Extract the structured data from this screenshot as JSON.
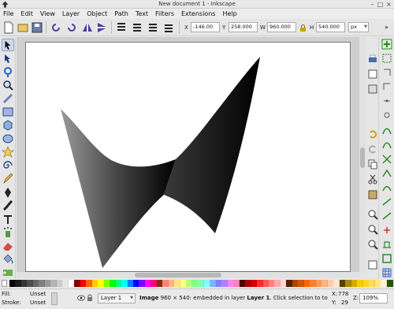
{
  "window": {
    "title": "New document 1 - Inkscape",
    "controls": [
      "minimize-icon",
      "maximize-icon",
      "close-icon"
    ]
  },
  "menu": [
    "File",
    "Edit",
    "View",
    "Layer",
    "Object",
    "Path",
    "Text",
    "Filters",
    "Extensions",
    "Help"
  ],
  "toolbar": {
    "x_label": "X",
    "x_value": "-146.00",
    "y_label": "Y",
    "y_value": "258.000",
    "w_label": "W",
    "w_value": "960.000",
    "h_label": "H",
    "h_value": "540.000",
    "unit": "px"
  },
  "status": {
    "fill_label": "Fill:",
    "stroke_label": "Stroke:",
    "fill_value": "Unset",
    "stroke_value": "Unset",
    "layer": "Layer 1",
    "message_bold1": "Image",
    "message_part1": "960 × 540: embedded in layer",
    "message_bold2": "Layer 1",
    "message_part2": ". Click selection to to",
    "x_label": "X:",
    "x_value": "778",
    "y_label": "Y:",
    "y_value": "29",
    "zoom_label": "Z:",
    "zoom_value": "109%"
  },
  "colors": {
    "shape_dark": "#000000",
    "shape_light": "#9a9a9a",
    "page_border": "#777777",
    "canvas_bg": "#cfcfcf"
  },
  "palette": [
    "#000000",
    "#1a1a1a",
    "#333333",
    "#4d4d4d",
    "#666666",
    "#808080",
    "#999999",
    "#b3b3b3",
    "#cccccc",
    "#e6e6e6",
    "#ffffff",
    "#800000",
    "#ff0000",
    "#ff6600",
    "#ffcc00",
    "#ffff00",
    "#80ff00",
    "#00ff00",
    "#00ff80",
    "#00ffff",
    "#0080ff",
    "#0000ff",
    "#8000ff",
    "#ff00ff",
    "#ff0080",
    "#803300",
    "#ff8080",
    "#ffb380",
    "#ffe680",
    "#ffff80",
    "#b3ff80",
    "#80ff80",
    "#80ffb3",
    "#80ffff",
    "#80b3ff",
    "#8080ff",
    "#b380ff",
    "#ff80ff",
    "#ff80b3",
    "#550000",
    "#aa0000",
    "#d40000",
    "#ff2a2a",
    "#ff5555",
    "#ff8080",
    "#ffaaaa",
    "#ffd5d5",
    "#552200",
    "#aa4400",
    "#d45500",
    "#ff6600",
    "#ff7f2a",
    "#ff9955",
    "#ffb380",
    "#ffccaa",
    "#ffe6d5",
    "#554400",
    "#aa8800",
    "#d4aa00",
    "#ffcc00",
    "#ffd42a",
    "#ffdd55",
    "#ffe680",
    "#fff6d5",
    "#225500"
  ]
}
